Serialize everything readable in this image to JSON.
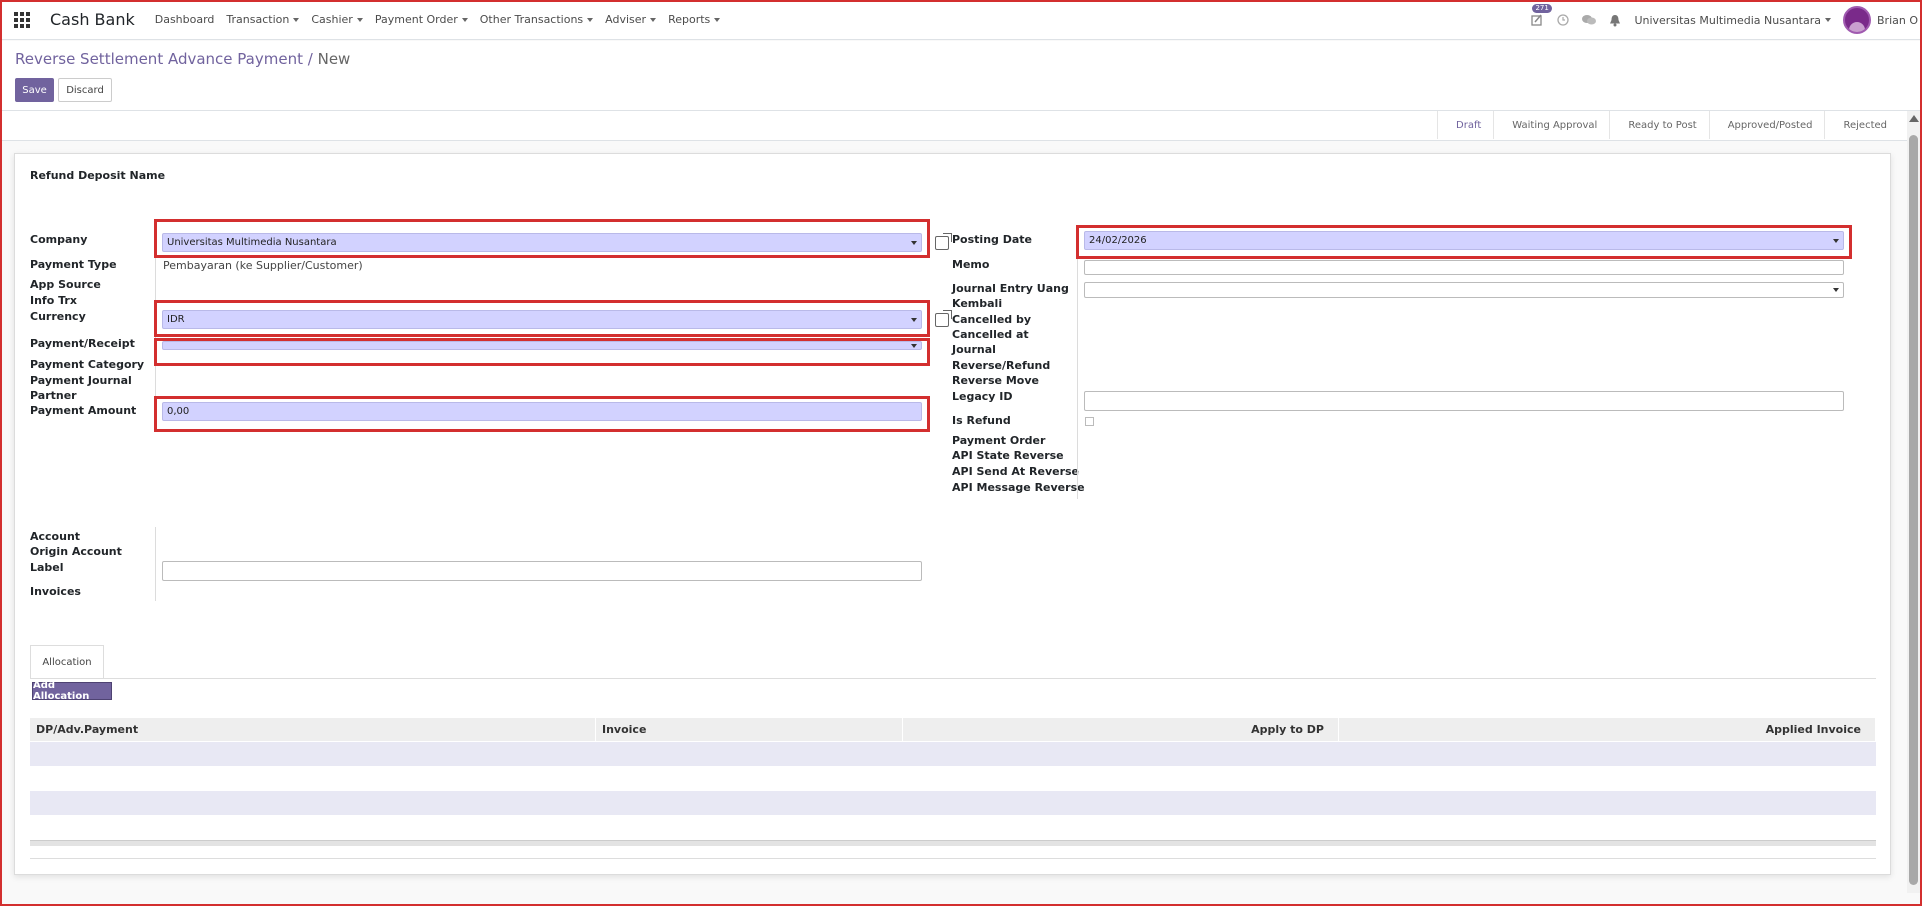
{
  "navbar": {
    "app_name": "Cash Bank",
    "menu": [
      "Dashboard",
      "Transaction",
      "Cashier",
      "Payment Order",
      "Other Transactions",
      "Adviser",
      "Reports"
    ],
    "activity_count": "271",
    "company": "Universitas Multimedia Nusantara",
    "user": "Brian O"
  },
  "breadcrumb": {
    "parent": "Reverse Settlement Advance Payment",
    "current": "New"
  },
  "buttons": {
    "save": "Save",
    "discard": "Discard"
  },
  "statusbar": [
    "Draft",
    "Waiting Approval",
    "Ready to Post",
    "Approved/Posted",
    "Rejected"
  ],
  "form": {
    "title": "Refund Deposit Name",
    "left": {
      "company_label": "Company",
      "company_value": "Universitas Multimedia Nusantara",
      "payment_type_label": "Payment Type",
      "payment_type_value": "Pembayaran (ke Supplier/Customer)",
      "app_source_label": "App Source",
      "info_trx_label": "Info Trx",
      "currency_label": "Currency",
      "currency_value": "IDR",
      "payment_receipt_label": "Payment/Receipt",
      "payment_category_label": "Payment Category",
      "payment_journal_label": "Payment Journal",
      "partner_label": "Partner",
      "payment_amount_label": "Payment Amount",
      "payment_amount_value": "0,00"
    },
    "right": {
      "posting_date_label": "Posting Date",
      "posting_date_value": "24/02/2026",
      "memo_label": "Memo",
      "journal_entry_label_1": "Journal Entry Uang",
      "journal_entry_label_2": "Kembali",
      "cancelled_by_label": "Cancelled by",
      "cancelled_at_label": "Cancelled at",
      "journal_label": "Journal",
      "reverse_refund_label": "Reverse/Refund",
      "reverse_move_label": "Reverse Move",
      "legacy_id_label": "Legacy ID",
      "is_refund_label": "Is Refund",
      "payment_order_label": "Payment Order",
      "api_state_label": "API State Reverse",
      "api_send_label": "API Send At Reverse",
      "api_message_label": "API Message Reverse"
    },
    "lower": {
      "account_label": "Account",
      "origin_account_label": "Origin Account",
      "label_label": "Label",
      "invoices_label": "Invoices"
    }
  },
  "tabs": {
    "allocation": "Allocation"
  },
  "allocation": {
    "add_button": "Add Allocation",
    "columns": [
      "DP/Adv.Payment",
      "Invoice",
      "Apply to DP",
      "Applied Invoice"
    ]
  }
}
